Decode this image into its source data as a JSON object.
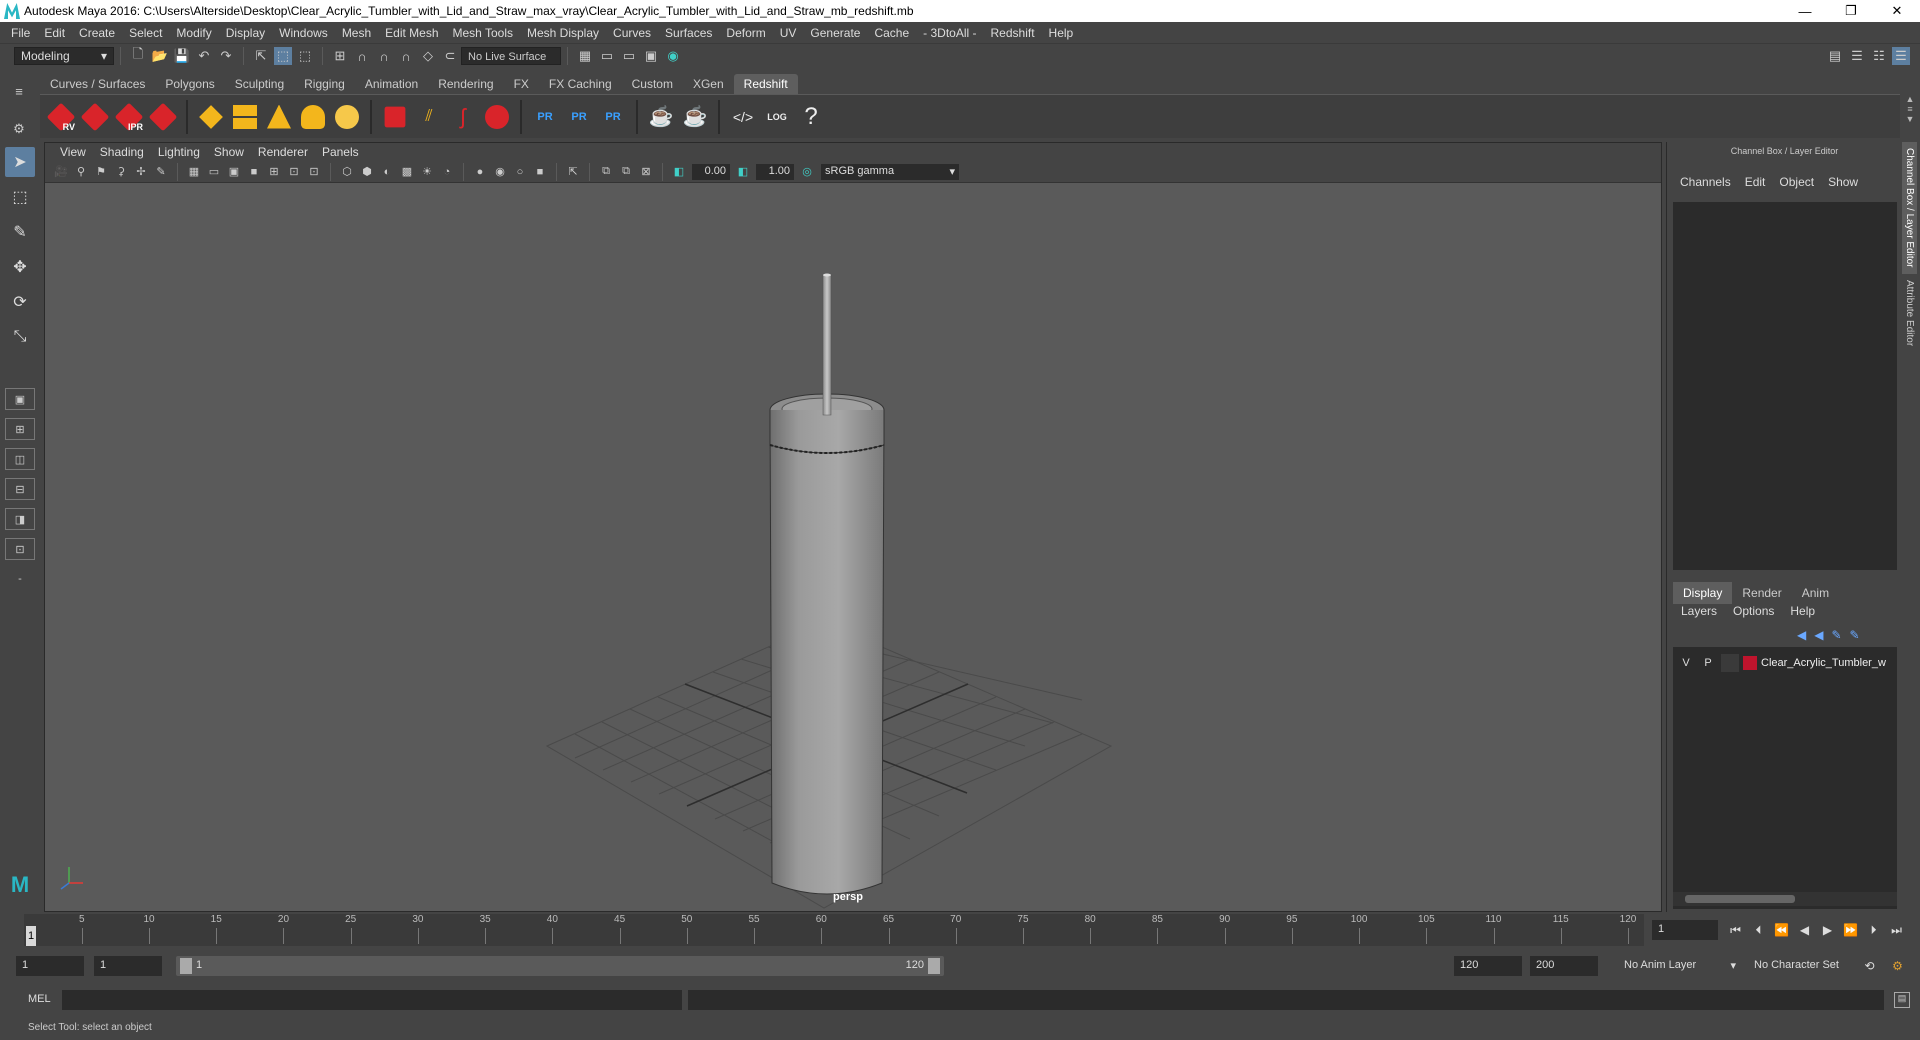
{
  "window": {
    "title": "Autodesk Maya 2016: C:\\Users\\Alterside\\Desktop\\Clear_Acrylic_Tumbler_with_Lid_and_Straw_max_vray\\Clear_Acrylic_Tumbler_with_Lid_and_Straw_mb_redshift.mb",
    "minimize": "—",
    "maximize": "❐",
    "close": "✕"
  },
  "menu": [
    "File",
    "Edit",
    "Create",
    "Select",
    "Modify",
    "Display",
    "Windows",
    "Mesh",
    "Edit Mesh",
    "Mesh Tools",
    "Mesh Display",
    "Curves",
    "Surfaces",
    "Deform",
    "UV",
    "Generate",
    "Cache",
    "- 3DtoAll -",
    "Redshift",
    "Help"
  ],
  "status": {
    "mode": "Modeling",
    "live_surface": "No Live Surface"
  },
  "shelf": {
    "tabs": [
      "Curves / Surfaces",
      "Polygons",
      "Sculpting",
      "Rigging",
      "Animation",
      "Rendering",
      "FX",
      "FX Caching",
      "Custom",
      "XGen",
      "Redshift"
    ],
    "active_tab": "Redshift",
    "icon_labels": {
      "rv": "RV",
      "ipr": "IPR",
      "pr1": "PR",
      "pr2": "PR",
      "pr3": "PR",
      "log": "LOG",
      "help": "?"
    }
  },
  "panel": {
    "menu": [
      "View",
      "Shading",
      "Lighting",
      "Show",
      "Renderer",
      "Panels"
    ],
    "exposure": "0.00",
    "gamma": "1.00",
    "color_space": "sRGB gamma",
    "camera": "persp"
  },
  "channel_box": {
    "title": "Channel Box / Layer Editor",
    "menu": [
      "Channels",
      "Edit",
      "Object",
      "Show"
    ],
    "layer_tabs": [
      "Display",
      "Render",
      "Anim"
    ],
    "active_layer_tab": "Display",
    "layer_menu": [
      "Layers",
      "Options",
      "Help"
    ],
    "layer": {
      "visible": "V",
      "playback": "P",
      "name": "Clear_Acrylic_Tumbler_w",
      "color": "#c0142d"
    }
  },
  "side_tabs": [
    "Channel Box / Layer Editor",
    "Attribute Editor"
  ],
  "timeline": {
    "labels": [
      "5",
      "10",
      "15",
      "20",
      "25",
      "30",
      "35",
      "40",
      "45",
      "50",
      "55",
      "60",
      "65",
      "70",
      "75",
      "80",
      "85",
      "90",
      "95",
      "100",
      "105",
      "110",
      "115",
      "120"
    ],
    "current_frame": "1",
    "frame_field": "1",
    "range_start": "1",
    "playback_start": "1",
    "range_handle_start": "1",
    "range_handle_end": "120",
    "range_end": "120",
    "anim_end": "200",
    "anim_layer": "No Anim Layer",
    "character_set": "No Character Set"
  },
  "command": {
    "label": "MEL",
    "help": "Select Tool: select an object"
  }
}
